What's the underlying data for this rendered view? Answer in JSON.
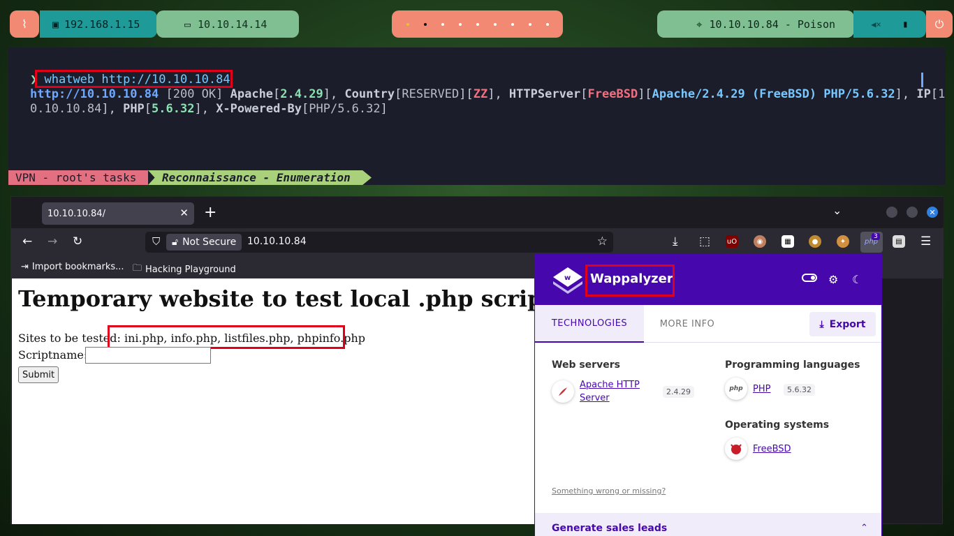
{
  "topbar": {
    "local_ip": "192.168.1.15",
    "vpn_ip": "10.10.14.14",
    "target": "10.10.10.84 - Poison",
    "workspace_count": 9,
    "active_workspace": 2
  },
  "terminal": {
    "prompt": "❯",
    "command": "whatweb http://10.10.10.84",
    "output": {
      "url": "http://10.10.10.84",
      "status": "[200 OK]",
      "apache_label": "Apache",
      "apache_ver": "2.4.29",
      "country_label": "Country",
      "country_val": "RESERVED",
      "country_code": "ZZ",
      "httpserver_label": "HTTPServer",
      "httpserver_os": "FreeBSD",
      "httpserver_val": "Apache/2.4.29 (FreeBSD) PHP/5.6.32",
      "ip_label": "IP",
      "ip_val_part1": "1",
      "ip_val_part2": "0.10.10.84",
      "php_label": "PHP",
      "php_ver": "5.6.32",
      "xpb_label": "X-Powered-By",
      "xpb_val": "PHP/5.6.32"
    },
    "status_left": "VPN - root's tasks",
    "status_right": "Reconnaissance - Enumeration"
  },
  "browser": {
    "tab_title": "10.10.10.84/",
    "security_label": "Not Secure",
    "url": "10.10.10.84",
    "extension_badge": "3",
    "bookmarks": [
      "Import bookmarks...",
      "Hacking Playground"
    ]
  },
  "page": {
    "title": "Temporary website to test local .php scripts.",
    "sites_label": "Sites to be tested:",
    "sites_list": "ini.php, info.php, listfiles.php, phpinfo.php",
    "script_label": "Scriptname:",
    "submit_label": "Submit"
  },
  "wappalyzer": {
    "name": "Wappalyzer",
    "tabs": [
      "TECHNOLOGIES",
      "MORE INFO"
    ],
    "export_label": "Export",
    "categories": [
      {
        "title": "Web servers",
        "techs": [
          {
            "name": "Apache HTTP Server",
            "version": "2.4.29"
          }
        ]
      },
      {
        "title": "Programming languages",
        "techs": [
          {
            "name": "PHP",
            "version": "5.6.32"
          }
        ]
      },
      {
        "title": "Operating systems",
        "techs": [
          {
            "name": "FreeBSD",
            "version": ""
          }
        ]
      }
    ],
    "feedback_link": "Something wrong or missing?",
    "leads_label": "Generate sales leads"
  },
  "colors": {
    "accent_purple": "#4608ad",
    "highlight_red": "#e1001a",
    "terminal_bg": "#1b1d2b"
  }
}
